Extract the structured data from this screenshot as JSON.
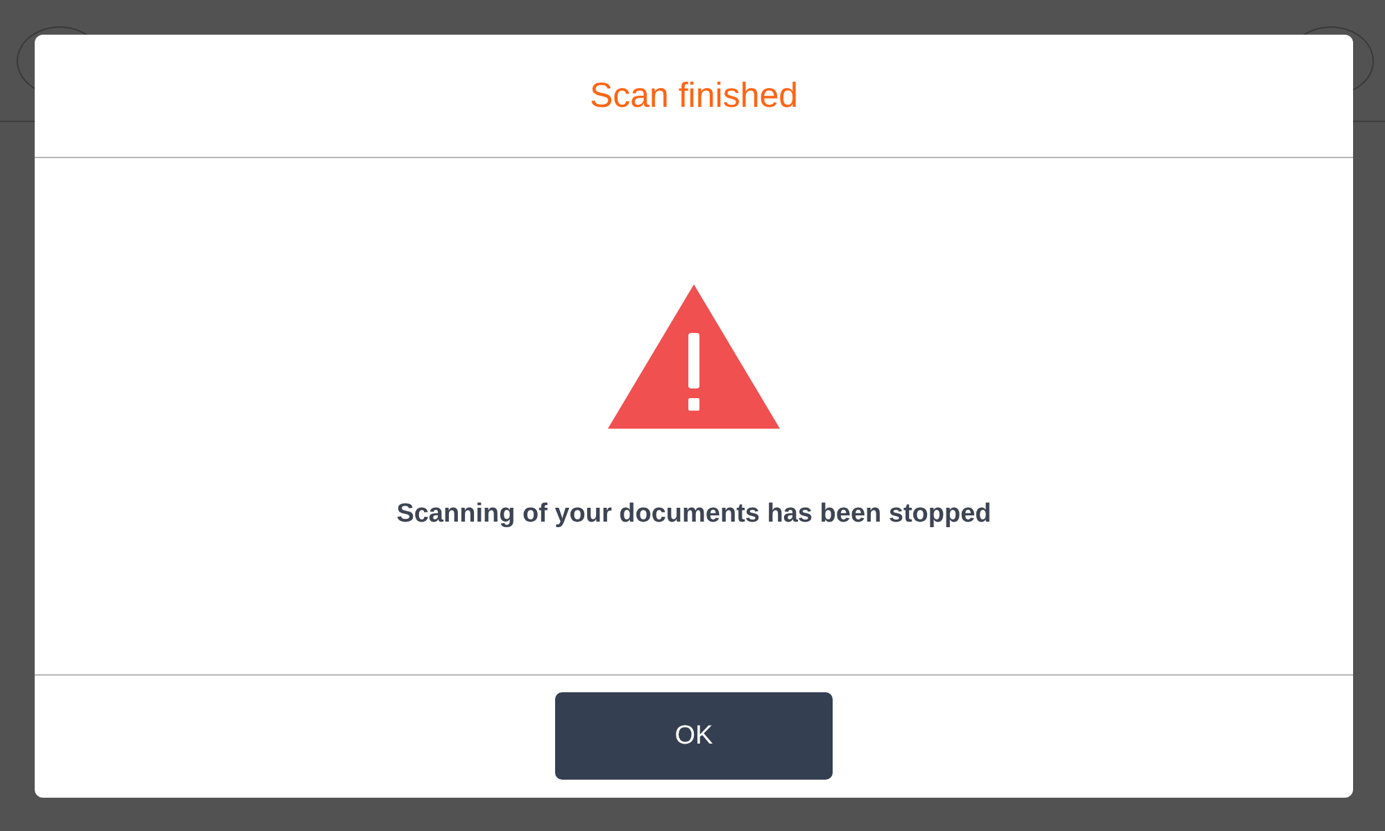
{
  "dialog": {
    "title": "Scan finished",
    "kind": "warning",
    "message": "Scanning of your documents has been stopped",
    "buttons": [
      "OK"
    ]
  }
}
